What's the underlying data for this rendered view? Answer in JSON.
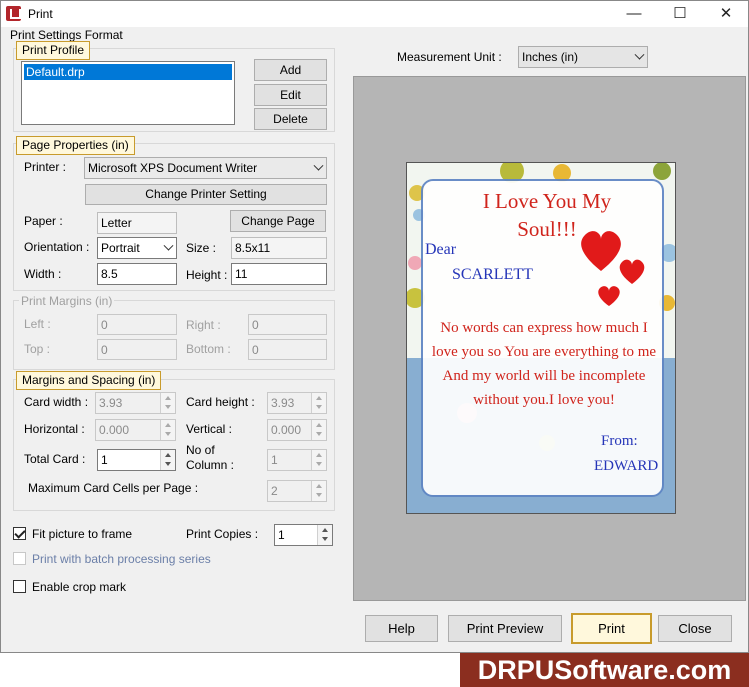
{
  "window": {
    "title": "Print",
    "minimize": "—",
    "maximize": "☐",
    "close": "✕"
  },
  "print_settings_format_label": "Print Settings Format",
  "print_profile": {
    "title": "Print Profile",
    "profiles": [
      "Default.drp"
    ],
    "add": "Add",
    "edit": "Edit",
    "delete": "Delete"
  },
  "page_properties": {
    "title": "Page Properties  (in)",
    "printer_label": "Printer :",
    "printer_value": "Microsoft XPS Document Writer",
    "change_printer_setting": "Change Printer Setting",
    "paper_label": "Paper :",
    "paper_value": "Letter",
    "change_page": "Change Page",
    "orientation_label": "Orientation :",
    "orientation_value": "Portrait",
    "size_label": "Size :",
    "size_value": "8.5x11",
    "width_label": "Width :",
    "width_value": "8.5",
    "height_label": "Height :",
    "height_value": "11"
  },
  "print_margins": {
    "title": "Print Margins (in)",
    "left_label": "Left :",
    "left_value": "0",
    "right_label": "Right :",
    "right_value": "0",
    "top_label": "Top :",
    "top_value": "0",
    "bottom_label": "Bottom :",
    "bottom_value": "0"
  },
  "margins_spacing": {
    "title": "Margins and Spacing  (in)",
    "card_width_label": "Card width :",
    "card_width_value": "3.93",
    "card_height_label": "Card height :",
    "card_height_value": "3.93",
    "horizontal_label": "Horizontal :",
    "horizontal_value": "0.000",
    "vertical_label": "Vertical :",
    "vertical_value": "0.000",
    "total_card_label": "Total Card :",
    "total_card_value": "1",
    "no_of_label_1": "No of",
    "no_of_label_2": "Column :",
    "no_of_column_value": "1",
    "max_cells_label": "Maximum Card Cells per Page :",
    "max_cells_value": "2"
  },
  "options": {
    "fit_picture": "Fit picture to frame",
    "print_copies_label": "Print Copies :",
    "print_copies_value": "1",
    "batch": "Print with batch processing series",
    "crop_mark": "Enable crop mark"
  },
  "measurement": {
    "label": "Measurement Unit :",
    "value": "Inches (in)"
  },
  "card": {
    "heading_1": "I Love You My",
    "heading_2": "Soul!!!",
    "dear": "Dear",
    "name_to": "SCARLETT",
    "message": [
      "No words can express how much I",
      "love you so You are everything to me",
      "And my world will be incomplete",
      "without you.I love you!"
    ],
    "from": "From:",
    "name_from": "EDWARD"
  },
  "buttons": {
    "help": "Help",
    "print_preview": "Print Preview",
    "print": "Print",
    "close": "Close"
  },
  "banner": "DRPUSoftware.com",
  "colors": {
    "accent_label_bg": "#fff8dc",
    "accent_label_border": "#c89b2c",
    "preview_bg": "#b5b5b5",
    "banner_bg": "#8b2e1f",
    "card_red": "#d0241c",
    "card_blue": "#2535b8"
  }
}
